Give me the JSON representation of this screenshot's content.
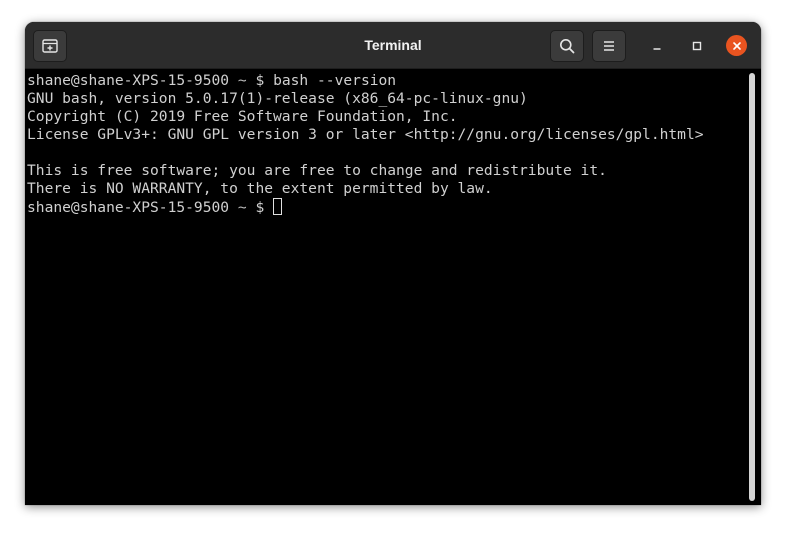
{
  "window": {
    "title": "Terminal"
  },
  "icons": {
    "new_tab": "new-tab-icon",
    "search": "search-icon",
    "menu": "hamburger-menu-icon",
    "minimize": "minimize-icon",
    "maximize": "maximize-icon",
    "close": "close-icon"
  },
  "colors": {
    "titlebar": "#2c2c2c",
    "terminal_bg": "#000000",
    "terminal_fg": "#d0d0d0",
    "close_button": "#e95420"
  },
  "terminal": {
    "prompt_user_host": "shane@shane-XPS-15-9500",
    "prompt_dir": "~",
    "prompt_symbol": "$",
    "command": "bash --version",
    "output": [
      "GNU bash, version 5.0.17(1)-release (x86_64-pc-linux-gnu)",
      "Copyright (C) 2019 Free Software Foundation, Inc.",
      "License GPLv3+: GNU GPL version 3 or later <http://gnu.org/licenses/gpl.html>",
      "",
      "This is free software; you are free to change and redistribute it.",
      "There is NO WARRANTY, to the extent permitted by law."
    ]
  }
}
